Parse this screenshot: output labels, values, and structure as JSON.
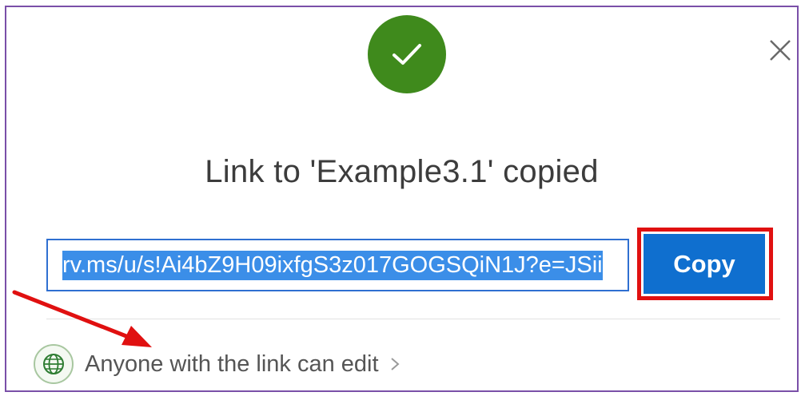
{
  "dialog": {
    "title": "Link to 'Example3.1' copied",
    "link_value": "rv.ms/u/s!Ai4bZ9H09ixfgS3z017GOGSQiN1J?e=JSii",
    "copy_label": "Copy",
    "permission_text": "Anyone with the link can edit",
    "success_icon": "checkmark-icon",
    "close_icon": "close-icon",
    "permission_icon": "globe-icon"
  },
  "colors": {
    "success": "#3f8a1c",
    "accent": "#0f6fcf",
    "annotation": "#e01010",
    "frame": "#7a4fa8"
  }
}
